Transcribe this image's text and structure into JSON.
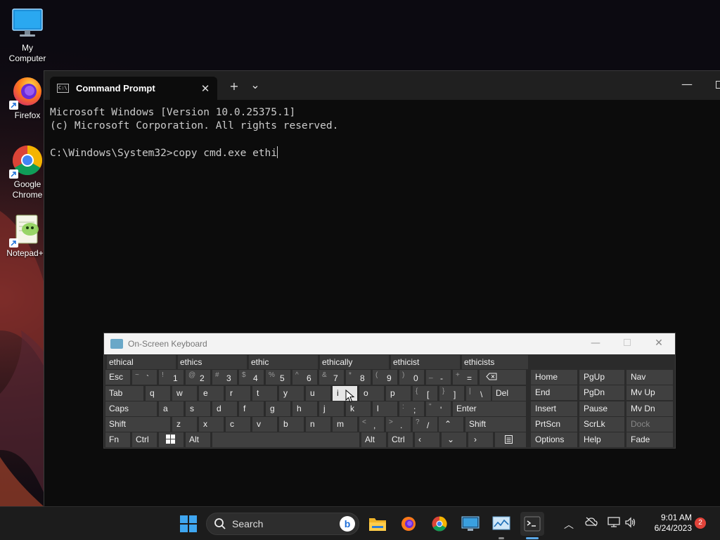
{
  "desktop": {
    "icons": [
      {
        "label": "My Computer"
      },
      {
        "label": "Firefox"
      },
      {
        "label": "Google Chrome"
      },
      {
        "label": "Notepad++"
      }
    ]
  },
  "terminal": {
    "tab_title": "Command Prompt",
    "tab_close": "✕",
    "new_tab": "+",
    "dropdown": "⌄",
    "minimize": "—",
    "lines": [
      "Microsoft Windows [Version 10.0.25375.1]",
      "(c) Microsoft Corporation. All rights reserved.",
      "",
      "C:\\Windows\\System32>copy cmd.exe ethi"
    ]
  },
  "osk": {
    "title": "On-Screen Keyboard",
    "predictions": [
      "ethical",
      "ethics",
      "ethic",
      "ethically",
      "ethicist",
      "ethicists"
    ],
    "keys": {
      "esc": "Esc",
      "tab": "Tab",
      "caps": "Caps",
      "shift_l": "Shift",
      "fn": "Fn",
      "ctrl_l": "Ctrl",
      "alt_l": "Alt",
      "alt_r": "Alt",
      "ctrl_r": "Ctrl",
      "del": "Del",
      "enter": "Enter",
      "shift_r": "Shift",
      "num": [
        {
          "s": "~",
          "m": "`"
        },
        {
          "s": "!",
          "m": "1"
        },
        {
          "s": "@",
          "m": "2"
        },
        {
          "s": "#",
          "m": "3"
        },
        {
          "s": "$",
          "m": "4"
        },
        {
          "s": "%",
          "m": "5"
        },
        {
          "s": "^",
          "m": "6"
        },
        {
          "s": "&",
          "m": "7"
        },
        {
          "s": "*",
          "m": "8"
        },
        {
          "s": "(",
          "m": "9"
        },
        {
          "s": ")",
          "m": "0"
        },
        {
          "s": "_",
          "m": "-"
        },
        {
          "s": "+",
          "m": "="
        }
      ],
      "row_q": [
        "q",
        "w",
        "e",
        "r",
        "t",
        "y",
        "u",
        "i",
        "o",
        "p"
      ],
      "row_q_sym": [
        {
          "s": "{",
          "m": "["
        },
        {
          "s": "}",
          "m": "]"
        },
        {
          "s": "|",
          "m": "\\"
        }
      ],
      "row_a": [
        "a",
        "s",
        "d",
        "f",
        "g",
        "h",
        "j",
        "k",
        "l"
      ],
      "row_a_sym": [
        {
          "s": ":",
          "m": ";"
        },
        {
          "s": "\"",
          "m": "'"
        }
      ],
      "row_z": [
        "z",
        "x",
        "c",
        "v",
        "b",
        "n",
        "m"
      ],
      "row_z_sym": [
        {
          "s": "<",
          "m": ","
        },
        {
          "s": ">",
          "m": "."
        },
        {
          "s": "?",
          "m": "/"
        }
      ],
      "nav": [
        [
          "Home",
          "PgUp",
          "Nav"
        ],
        [
          "End",
          "PgDn",
          "Mv Up"
        ],
        [
          "Insert",
          "Pause",
          "Mv Dn"
        ],
        [
          "PrtScn",
          "ScrLk",
          "Dock"
        ],
        [
          "Options",
          "Help",
          "Fade"
        ]
      ]
    }
  },
  "taskbar": {
    "search_label": "Search",
    "time": "9:01 AM",
    "date": "6/24/2023",
    "notification_count": "2"
  }
}
